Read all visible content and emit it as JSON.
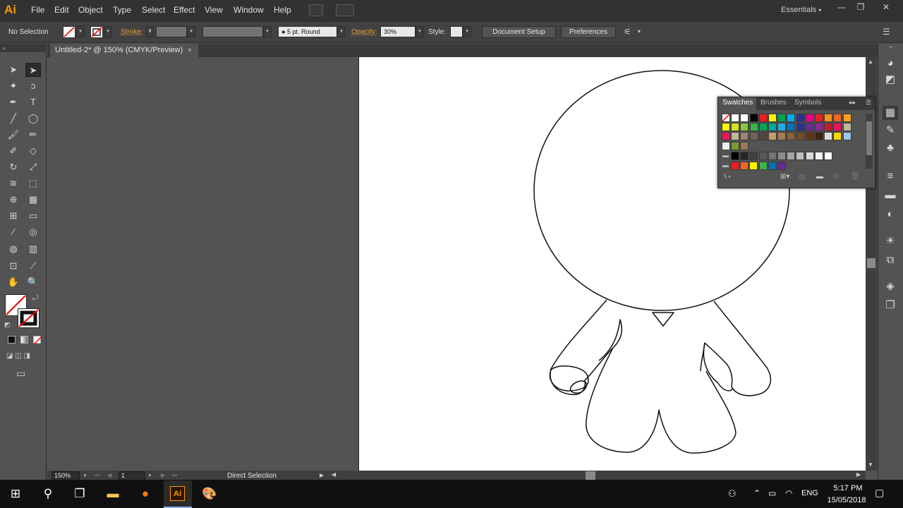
{
  "app": {
    "logo": "Ai"
  },
  "menu": [
    "File",
    "Edit",
    "Object",
    "Type",
    "Select",
    "Effect",
    "View",
    "Window",
    "Help"
  ],
  "workspace_switcher": "Essentials",
  "control_bar": {
    "selection_state": "No Selection",
    "stroke_label": "Stroke:",
    "brush_profile": "5 pt. Round",
    "opacity_label": "Opacity:",
    "opacity_value": "30%",
    "style_label": "Style:",
    "document_setup": "Document Setup",
    "preferences": "Preferences"
  },
  "document": {
    "tab_title": "Untitled-2* @ 150% (CMYK/Preview)",
    "close": "×"
  },
  "status_bar": {
    "zoom": "150%",
    "artboard_number": "1",
    "current_tool": "Direct Selection"
  },
  "swatches_panel": {
    "tabs": [
      "Swatches",
      "Brushes",
      "Symbols"
    ],
    "active_tab": "Swatches",
    "rows": [
      [
        "#ffffff",
        "#ffffff",
        "#ffffff",
        "#000000",
        "#e8201f",
        "#fff200",
        "#00a551",
        "#00aeef",
        "#2e3192",
        "#ec008c",
        "#ee1d24",
        "#f7941d",
        "#f26522",
        "#f7a41d"
      ],
      [
        "#fff200",
        "#d7df23",
        "#8dc63f",
        "#39b54a",
        "#00a651",
        "#00a99d",
        "#27aae1",
        "#0072bc",
        "#2e3192",
        "#662d91",
        "#92278f",
        "#be1e2d",
        "#ed145b",
        "#c2b59b"
      ],
      [
        "#ed145b",
        "#c2b59b",
        "#998675",
        "#736357",
        "#534741",
        "#c69c6d",
        "#a67c52",
        "#8c6239",
        "#754c24",
        "#603913",
        "#3c2415",
        "#dddddd",
        "#ffd700",
        "#a0c4e8"
      ]
    ],
    "gray_group": [
      "#000000",
      "#262626",
      "#404040",
      "#595959",
      "#737373",
      "#8c8c8c",
      "#a6a6a6",
      "#bfbfbf",
      "#d9d9d9",
      "#f2f2f2",
      "#ffffff"
    ],
    "bright_group": [
      "#ee1d24",
      "#f26522",
      "#fff200",
      "#39b54a",
      "#0072bc",
      "#662d91"
    ]
  },
  "tools": [
    "selection-tool",
    "direct-selection-tool",
    "magic-wand-tool",
    "lasso-tool",
    "pen-tool",
    "type-tool",
    "line-tool",
    "ellipse-tool",
    "paintbrush-tool",
    "pencil-tool",
    "shaper-tool",
    "eraser-tool",
    "rotate-tool",
    "scale-tool",
    "warp-tool",
    "free-transform-tool",
    "shape-builder-tool",
    "perspective-grid-tool",
    "mesh-tool",
    "gradient-tool",
    "eyedropper-tool",
    "blend-tool",
    "symbol-sprayer-tool",
    "column-graph-tool",
    "artboard-tool",
    "slice-tool",
    "hand-tool",
    "zoom-tool"
  ],
  "taskbar": {
    "language": "ENG",
    "time": "5:17 PM",
    "date": "15/05/2018"
  },
  "colors": {
    "accent_orange": "#ff9a00",
    "panel_bg": "#535353",
    "bar_bg": "#323232",
    "artboard": "#ffffff"
  }
}
